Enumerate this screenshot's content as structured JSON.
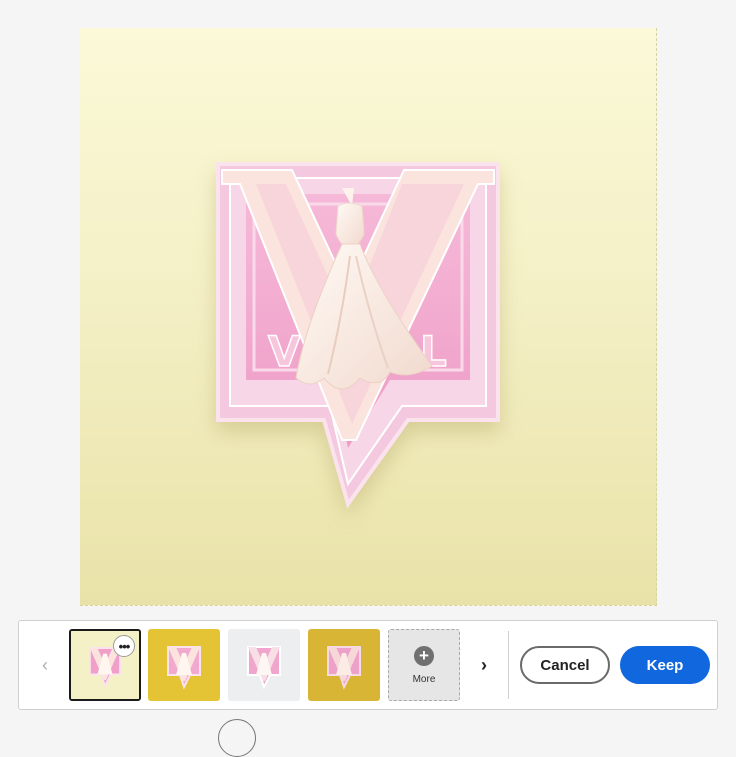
{
  "canvas": {
    "logo_letters": {
      "left": "V",
      "right": "L"
    },
    "colors": {
      "background_top": "#fbf9d8",
      "background_bottom": "#e9e2a8",
      "badge_pink": "#f2a8cf",
      "badge_frame": "#f7d3e4",
      "dress": "#fbeee6",
      "cream_v": "#fbe6df"
    }
  },
  "variations": {
    "thumbnails": [
      {
        "background": "#f4f1c6",
        "selected": true
      },
      {
        "background": "#e4c334",
        "selected": false
      },
      {
        "background": "#eceef0",
        "selected": false
      },
      {
        "background": "#d9b536",
        "selected": false
      }
    ],
    "thumb_more_glyph": "•••",
    "more_tile_glyph": "+",
    "more_label": "More",
    "prev_glyph": "‹",
    "next_glyph": "›"
  },
  "actions": {
    "cancel_label": "Cancel",
    "keep_label": "Keep",
    "keep_color": "#1167dd"
  }
}
